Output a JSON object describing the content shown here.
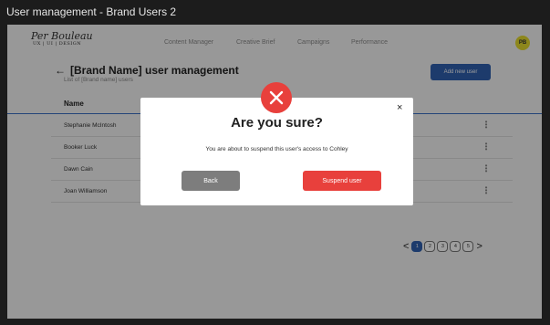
{
  "window": {
    "title": "User management - Brand Users 2"
  },
  "header": {
    "logo_text": "Per Bouleau",
    "logo_sub": "UX | UI | DESIGN",
    "nav": [
      "Content Manager",
      "Creative Brief",
      "Campaigns",
      "Performance"
    ],
    "avatar_initials": "PB",
    "avatar_color": "#e4da2e"
  },
  "page": {
    "back_icon": "arrow-left-icon",
    "title": "[Brand Name] user management",
    "subtitle": "List of [Brand name] users",
    "add_button": "Add new user",
    "accent_color": "#2f5fae"
  },
  "table": {
    "column_name": "Name",
    "rows": [
      "Stephanie McIntosh",
      "Booker Luck",
      "Dawn Cain",
      "Joan Williamson"
    ]
  },
  "pagination": {
    "prev": "<",
    "next": ">",
    "pages": [
      "1",
      "2",
      "3",
      "4",
      "5"
    ],
    "current": "1"
  },
  "modal": {
    "icon": "close-circle-icon",
    "icon_color": "#e8403c",
    "close_label": "×",
    "title": "Are you sure?",
    "message": "You are about to suspend this user's access to Cohley",
    "back_button": "Back",
    "suspend_button": "Suspend user"
  }
}
